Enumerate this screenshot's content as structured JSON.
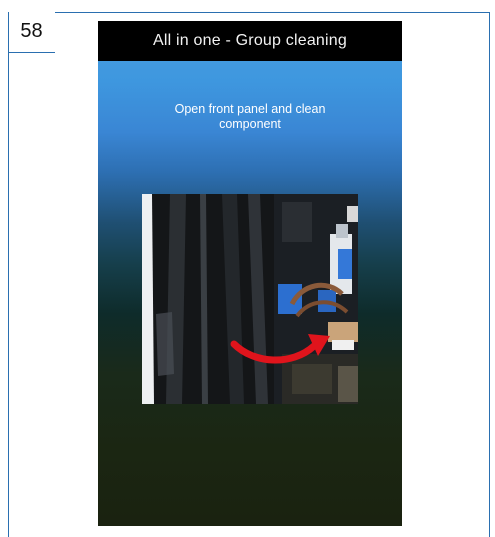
{
  "document": {
    "page_number": "58"
  },
  "screen": {
    "title": "All in one - Group cleaning",
    "instruction_line1": "Open front panel and clean",
    "instruction_line2": "component"
  },
  "colors": {
    "frame_line": "#2a6fb0",
    "titlebar_bg": "#000000",
    "gradient_top": "#4a9fe0",
    "gradient_bottom": "#1a2210",
    "arrow": "#e0141c"
  },
  "icons": {
    "photo_arrow": "curved-arrow-icon"
  }
}
